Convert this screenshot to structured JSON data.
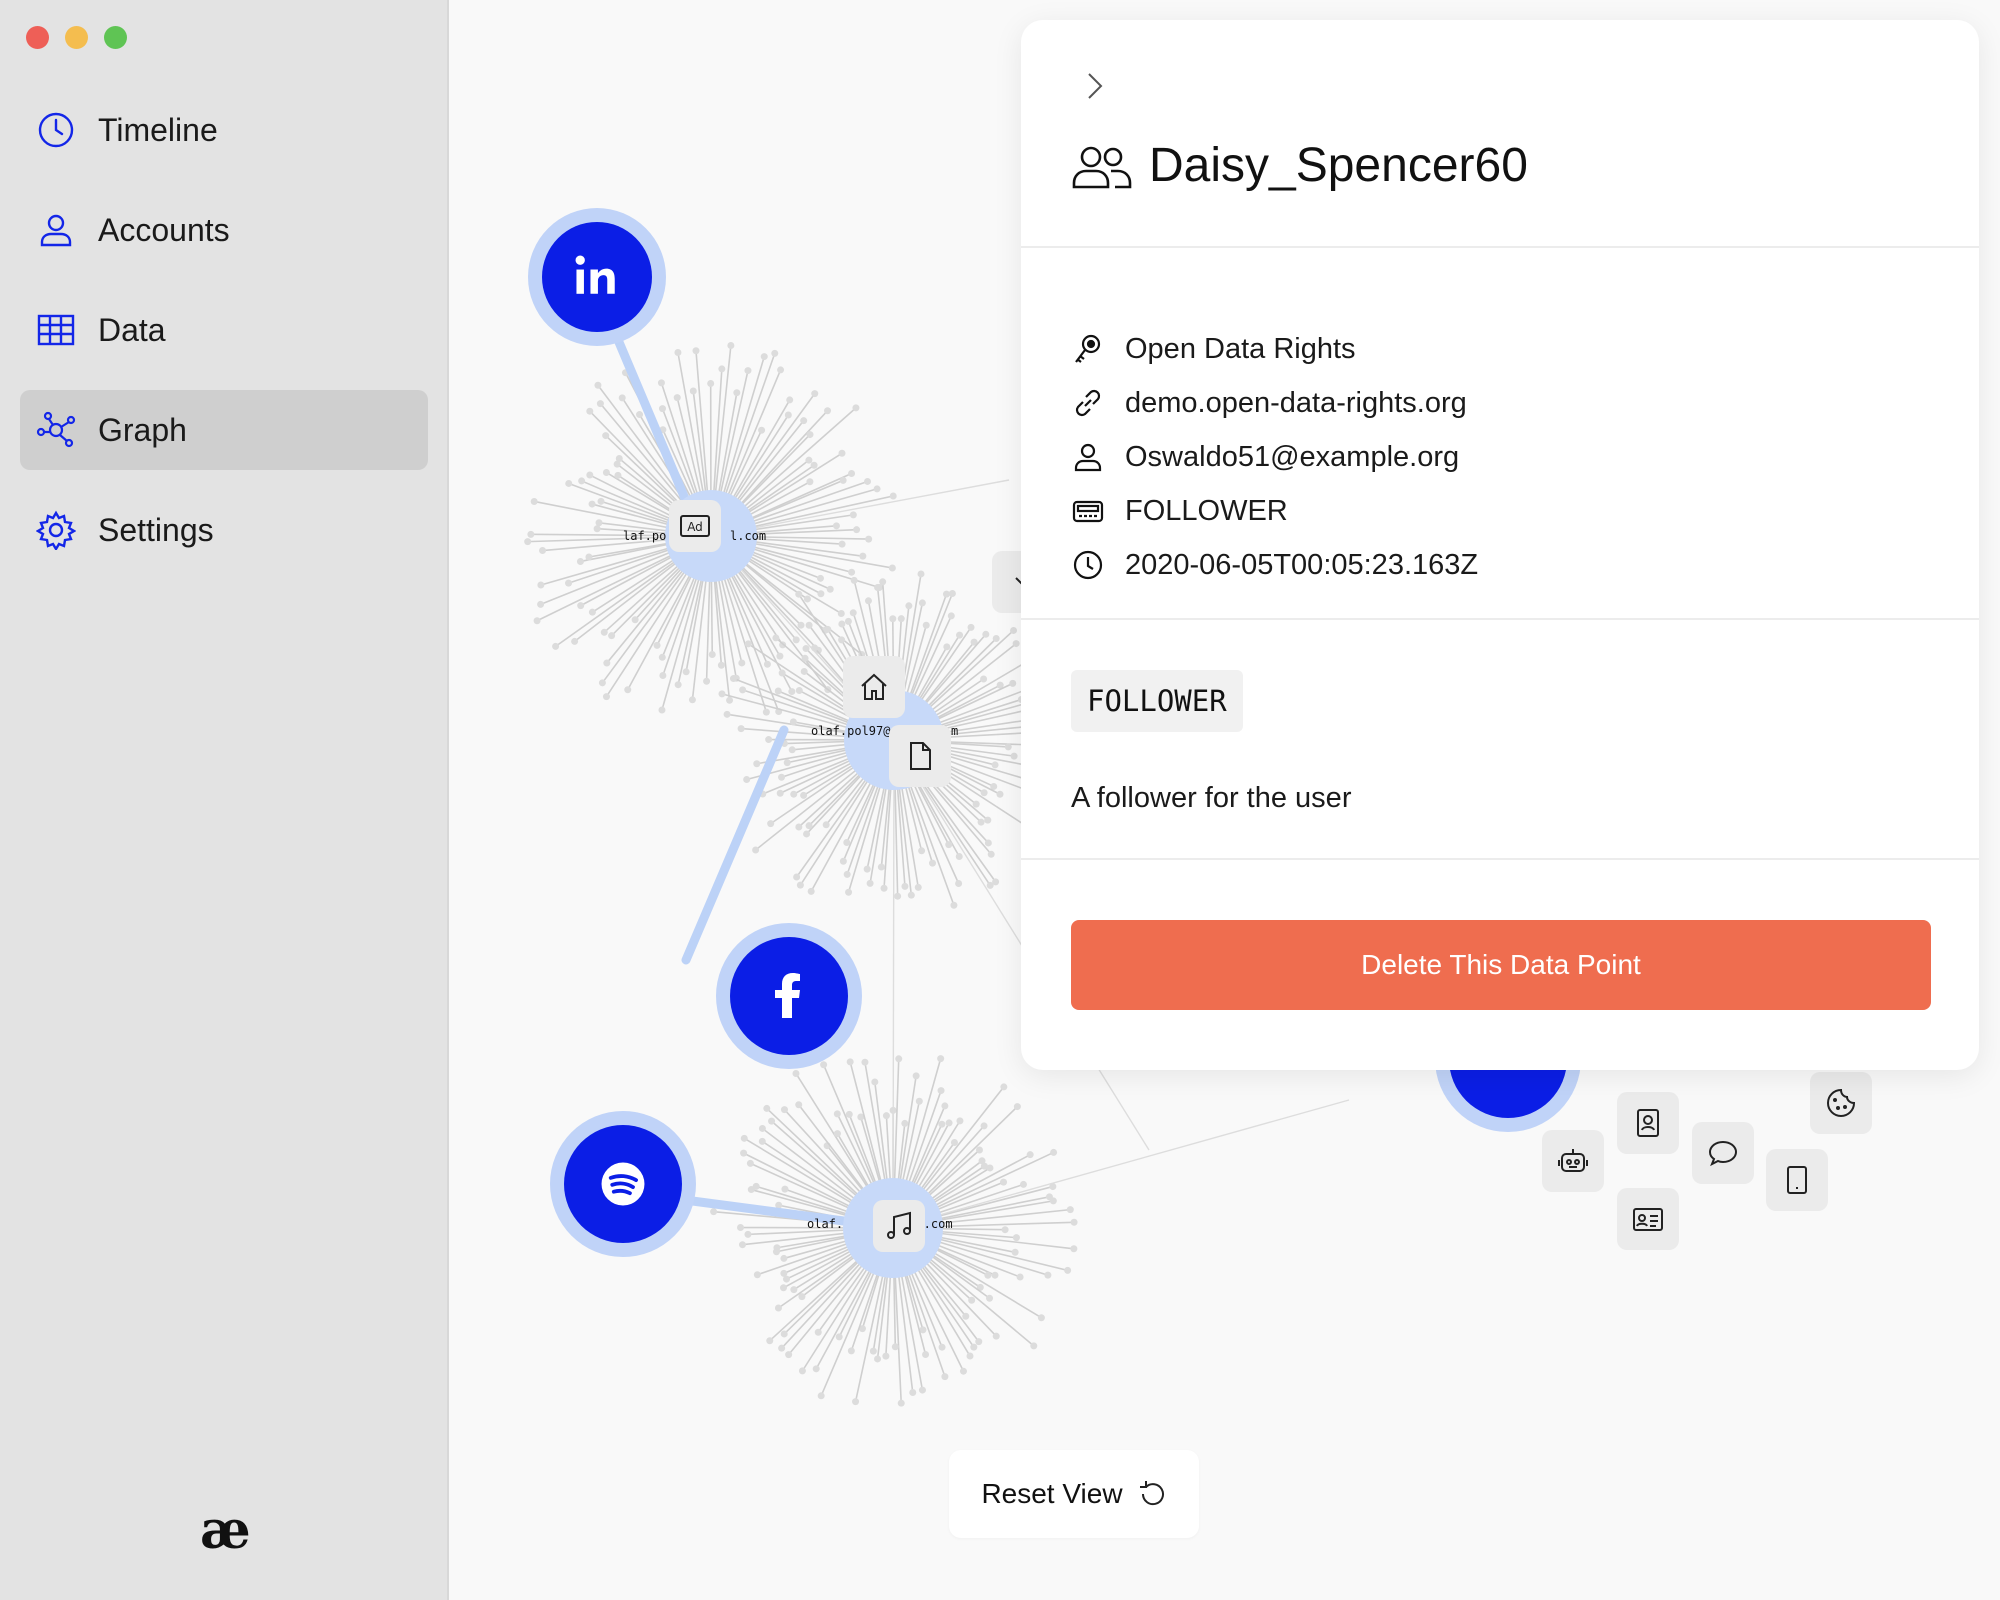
{
  "sidebar": {
    "items": [
      {
        "label": "Timeline",
        "icon": "clock-icon"
      },
      {
        "label": "Accounts",
        "icon": "user-icon"
      },
      {
        "label": "Data",
        "icon": "table-icon"
      },
      {
        "label": "Graph",
        "icon": "graph-icon",
        "active": true
      },
      {
        "label": "Settings",
        "icon": "gear-icon"
      }
    ],
    "logo_text": "æ"
  },
  "graph": {
    "hub_labels": [
      "laf.po",
      "l.com",
      "olaf.pol97@",
      "m",
      "olaf.",
      "ail.com"
    ],
    "platforms": [
      "linkedin",
      "facebook",
      "spotify"
    ],
    "reset_label": "Reset View"
  },
  "panel": {
    "title": "Daisy_Spencer60",
    "meta": {
      "source": "Open Data Rights",
      "url": "demo.open-data-rights.org",
      "account": "Oswaldo51@example.org",
      "type": "FOLLOWER",
      "timestamp": "2020-06-05T00:05:23.163Z"
    },
    "tag": "FOLLOWER",
    "description": "A follower for the user",
    "delete_label": "Delete This Data Point"
  },
  "colors": {
    "accent": "#0b1ee6",
    "danger": "#ef6d4f",
    "sidebar_bg": "#e3e3e3"
  }
}
